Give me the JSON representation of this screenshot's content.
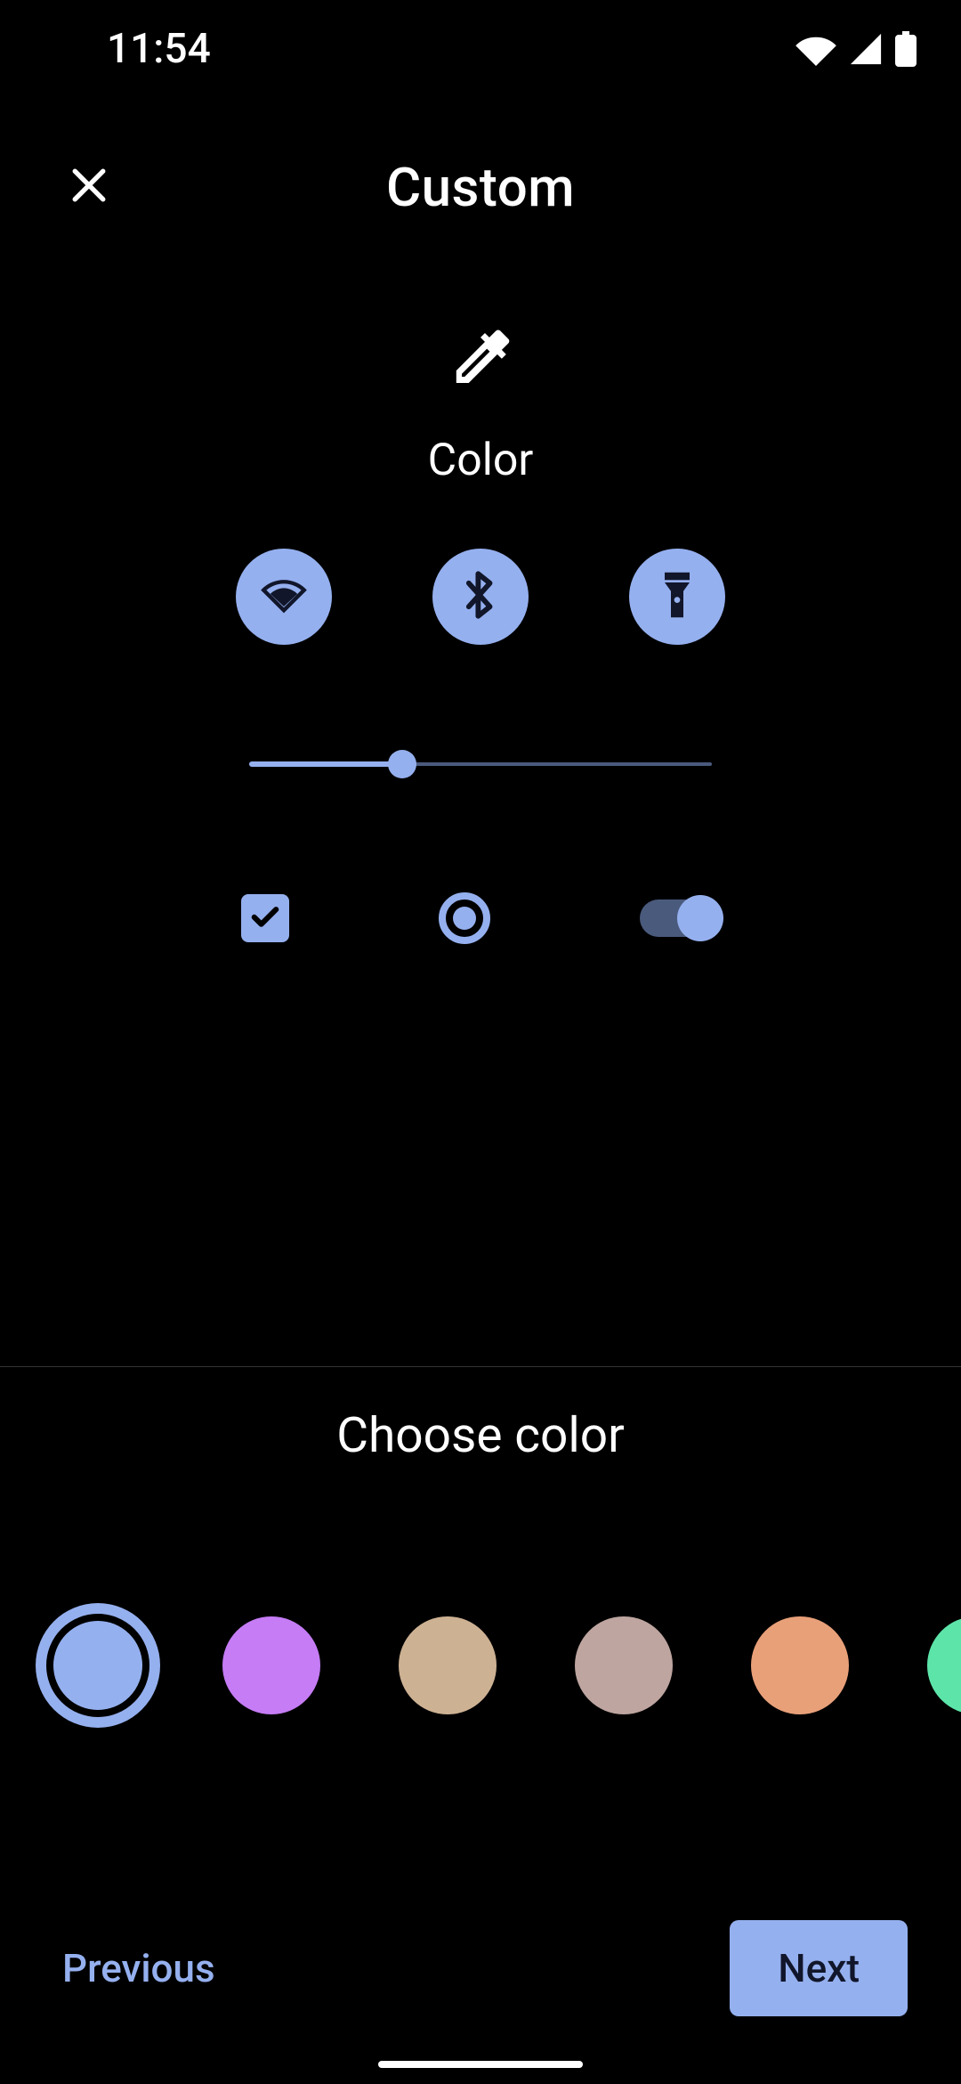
{
  "status": {
    "time": "11:54"
  },
  "header": {
    "title": "Custom"
  },
  "preview": {
    "section_label": "Color",
    "slider_percent": 33
  },
  "picker": {
    "title": "Choose color",
    "selected_index": 0,
    "swatches": [
      {
        "name": "cornflower",
        "hex": "#95b0ef"
      },
      {
        "name": "lavender",
        "hex": "#c57cf5"
      },
      {
        "name": "sand",
        "hex": "#cdb193"
      },
      {
        "name": "mauve",
        "hex": "#bea5a0"
      },
      {
        "name": "coral",
        "hex": "#e8a079"
      },
      {
        "name": "mint",
        "hex": "#5de5a9"
      }
    ]
  },
  "accent": "#95b0ef",
  "accent_track": "#4a5a7d",
  "nav": {
    "previous": "Previous",
    "next": "Next"
  }
}
